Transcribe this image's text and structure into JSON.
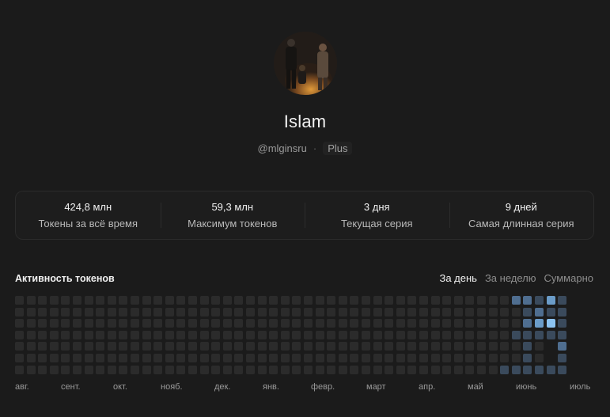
{
  "profile": {
    "name": "Islam",
    "handle": "@mlginsru",
    "separator": "·",
    "plan": "Plus"
  },
  "stats": [
    {
      "value": "424,8 млн",
      "label": "Токены за всё время"
    },
    {
      "value": "59,3 млн",
      "label": "Максимум токенов"
    },
    {
      "value": "3 дня",
      "label": "Текущая серия"
    },
    {
      "value": "9 дней",
      "label": "Самая длинная серия"
    }
  ],
  "activity": {
    "title": "Активность токенов",
    "tabs": [
      "За день",
      "За неделю",
      "Суммарно"
    ],
    "active_tab": "За день",
    "months": [
      "авг.",
      "сент.",
      "окт.",
      "нояб.",
      "дек.",
      "янв.",
      "февр.",
      "март",
      "апр.",
      "май",
      "июнь",
      "июль"
    ],
    "weeks": 50,
    "days_per_week": 7,
    "active_cells": [
      {
        "week": 43,
        "day": 0,
        "level": 2
      },
      {
        "week": 44,
        "day": 0,
        "level": 2
      },
      {
        "week": 45,
        "day": 0,
        "level": 1
      },
      {
        "week": 46,
        "day": 0,
        "level": 3
      },
      {
        "week": 47,
        "day": 0,
        "level": 1
      },
      {
        "week": 44,
        "day": 1,
        "level": 1
      },
      {
        "week": 45,
        "day": 1,
        "level": 2
      },
      {
        "week": 46,
        "day": 1,
        "level": 1
      },
      {
        "week": 47,
        "day": 1,
        "level": 1
      },
      {
        "week": 44,
        "day": 2,
        "level": 2
      },
      {
        "week": 45,
        "day": 2,
        "level": 3
      },
      {
        "week": 46,
        "day": 2,
        "level": 4
      },
      {
        "week": 47,
        "day": 2,
        "level": 1
      },
      {
        "week": 43,
        "day": 3,
        "level": 1
      },
      {
        "week": 44,
        "day": 3,
        "level": 1
      },
      {
        "week": 45,
        "day": 3,
        "level": 1
      },
      {
        "week": 46,
        "day": 3,
        "level": 1
      },
      {
        "week": 47,
        "day": 3,
        "level": 1
      },
      {
        "week": 44,
        "day": 4,
        "level": 1
      },
      {
        "week": 47,
        "day": 4,
        "level": 2
      },
      {
        "week": 44,
        "day": 5,
        "level": 1
      },
      {
        "week": 47,
        "day": 5,
        "level": 1
      },
      {
        "week": 42,
        "day": 6,
        "level": 1
      },
      {
        "week": 43,
        "day": 6,
        "level": 1
      },
      {
        "week": 44,
        "day": 6,
        "level": 1
      },
      {
        "week": 45,
        "day": 6,
        "level": 1
      },
      {
        "week": 46,
        "day": 6,
        "level": 1
      },
      {
        "week": 47,
        "day": 6,
        "level": 1
      }
    ],
    "future_cells_from_week": 46,
    "empty_color": "#2b2b2b",
    "level_colors": [
      "#2b2b2b",
      "#3a4a5c",
      "#4f6e90",
      "#6b9cc8",
      "#8cc3f0"
    ]
  },
  "colors": {
    "background": "#1b1b1b",
    "accent": "#8cc3f0"
  }
}
